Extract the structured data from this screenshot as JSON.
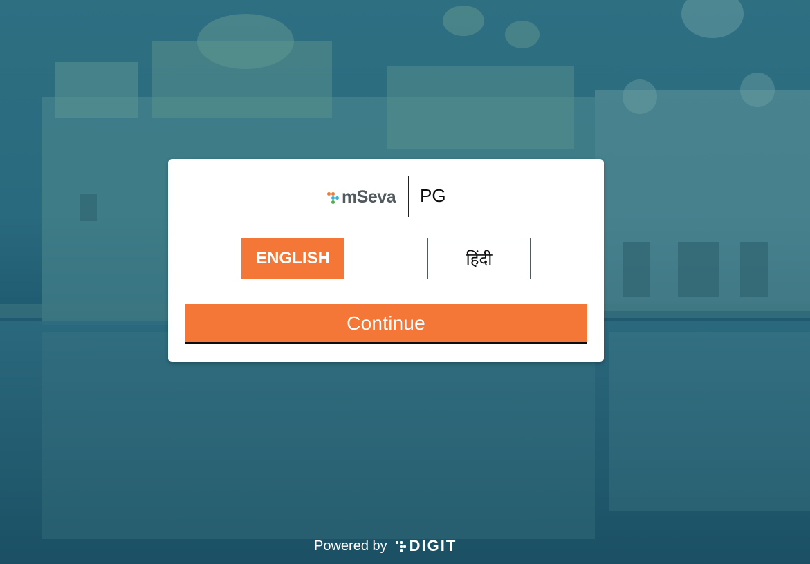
{
  "brand": {
    "logo_text": "mSeva",
    "city": "PG"
  },
  "language": {
    "options": [
      {
        "label": "ENGLISH",
        "selected": true
      },
      {
        "label": "हिंदी",
        "selected": false
      }
    ]
  },
  "actions": {
    "continue_label": "Continue"
  },
  "footer": {
    "powered_by": "Powered by",
    "digit_logo_text": "DIGIT"
  },
  "colors": {
    "primary": "#f47738",
    "background_overlay": "#2a6a7e",
    "card": "#ffffff",
    "text_dark": "#0b0c0c"
  },
  "icons": {
    "brand_logo": "mseva-logo-icon",
    "footer_logo": "digit-logo-icon"
  }
}
